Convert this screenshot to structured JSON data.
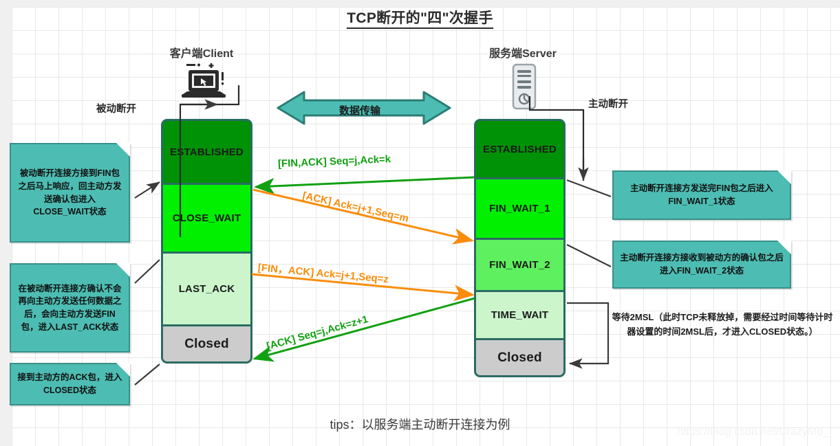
{
  "title": "TCP断开的\"四\"次握手",
  "tips": "tips：以服务端主动断开连接为例",
  "watermark": "https://blog.csdn.net/CrazyMo_",
  "colors": {
    "note_fill": "#4dbdb3",
    "note_border": "#3a8f88",
    "state_border": "#2a6b63",
    "established": "#009206",
    "bright_green": "#00f000",
    "mid_green": "#5ef05e",
    "light_green": "#ccf5cc",
    "closed_gray": "#cccccc",
    "arrow_green": "#11a011",
    "arrow_orange": "#fa8c0a",
    "data_arrow_teal": "#4dbdb3"
  },
  "client": {
    "header": "客户端Client",
    "icon": "laptop-icon",
    "side_label": "被动断开",
    "states": [
      {
        "label": "ESTABLISHED",
        "fill": "#009206"
      },
      {
        "label": "CLOSE_WAIT",
        "fill": "#00f000"
      },
      {
        "label": "LAST_ACK",
        "fill": "#ccf5cc"
      },
      {
        "label": "Closed",
        "fill": "#cccccc"
      }
    ]
  },
  "server": {
    "header": "服务端Server",
    "icon": "server-tower-icon",
    "side_label": "主动断开",
    "states": [
      {
        "label": "ESTABLISHED",
        "fill": "#009206"
      },
      {
        "label": "FIN_WAIT_1",
        "fill": "#00f000"
      },
      {
        "label": "FIN_WAIT_2",
        "fill": "#5ef05e"
      },
      {
        "label": "TIME_WAIT",
        "fill": "#ccf5cc"
      },
      {
        "label": "Closed",
        "fill": "#cccccc"
      }
    ]
  },
  "data_transfer": {
    "label": "数据传输",
    "icon": "bidirectional-arrow-icon"
  },
  "messages": [
    {
      "id": "msg1",
      "label": "[FIN,ACK]  Seq=j,Ack=k",
      "color": "green",
      "direction": "server-to-client"
    },
    {
      "id": "msg2",
      "label": "[ACK]  Ack=j+1,Seq=m",
      "color": "orange",
      "direction": "client-to-server"
    },
    {
      "id": "msg3",
      "label": "[FIN，ACK]  Ack=j+1,Seq=z",
      "color": "orange",
      "direction": "client-to-server"
    },
    {
      "id": "msg4",
      "label": "[ACK]  Seq=j,Ack=z+1",
      "color": "green",
      "direction": "server-to-client"
    }
  ],
  "left_notes": [
    {
      "id": "note-close-wait",
      "text": "被动断开连接方接到FIN包之后马上响应，回主动方发送确认包进入CLOSE_WAIT状态"
    },
    {
      "id": "note-last-ack",
      "text": "在被动断开连接方确认不会再向主动方发送任何数据之后，会向主动方发送FIN包，进入LAST_ACK状态"
    },
    {
      "id": "note-closed",
      "text": "接到主动方的ACK包，进入CLOSED状态"
    }
  ],
  "right_notes": [
    {
      "id": "note-fin-wait-1",
      "text": "主动断开连接方发送完FIN包之后进入FIN_WAIT_1状态"
    },
    {
      "id": "note-fin-wait-2",
      "text": "主动断开连接方接收到被动方的确认包之后进入FIN_WAIT_2状态"
    }
  ],
  "msl_note": {
    "id": "note-2msl",
    "text": "等待2MSL（此时TCP未释放掉，需要经过时间等待计时器设置的时间2MSL后，才进入CLOSED状态。）"
  }
}
